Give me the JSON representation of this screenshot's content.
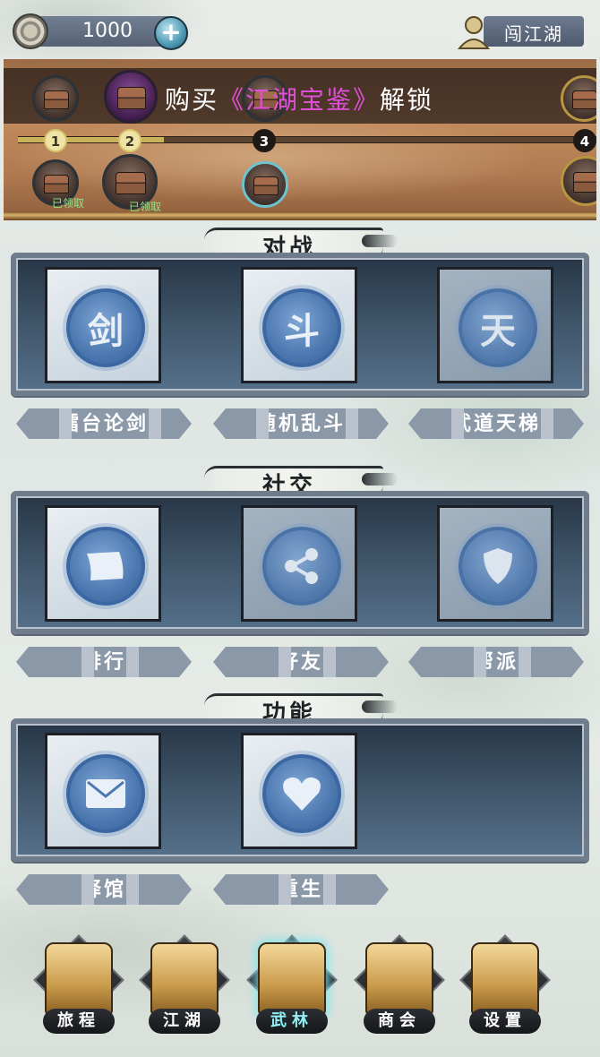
{
  "top": {
    "coins": "1000",
    "player_name": "闯江湖"
  },
  "battle_pass": {
    "unlock_prefix": "购买",
    "unlock_book": "《江湖宝鉴》",
    "unlock_suffix": "解锁",
    "progress": 0.25,
    "levels": [
      "1",
      "2",
      "3",
      "4"
    ],
    "claimed_label": "已领取"
  },
  "sections": [
    {
      "title": "对战",
      "items": [
        {
          "glyph": "剑",
          "label": "擂台论剑"
        },
        {
          "glyph": "斗",
          "label": "随机乱斗"
        },
        {
          "glyph": "天",
          "label": "武道天梯"
        }
      ]
    },
    {
      "title": "社交",
      "items": [
        {
          "icon": "scroll-icon",
          "label": "排行"
        },
        {
          "icon": "share-icon",
          "label": "好友"
        },
        {
          "icon": "shield-icon",
          "label": "帮派"
        }
      ]
    },
    {
      "title": "功能",
      "items": [
        {
          "icon": "envelope-icon",
          "label": "驿馆"
        },
        {
          "icon": "heart-icon",
          "label": "重生"
        }
      ]
    }
  ],
  "nav": [
    {
      "label": "旅程",
      "icon": "traveler-icon"
    },
    {
      "label": "江湖",
      "icon": "gate-icon"
    },
    {
      "label": "武林",
      "icon": "crossed-swords-icon",
      "active": true
    },
    {
      "label": "商会",
      "icon": "shop-icon"
    },
    {
      "label": "设置",
      "icon": "wheel-icon"
    }
  ],
  "colors": {
    "accent_book": "#e04fd8",
    "active_nav": "#8ff0f6",
    "claimed": "#8fe38a"
  }
}
